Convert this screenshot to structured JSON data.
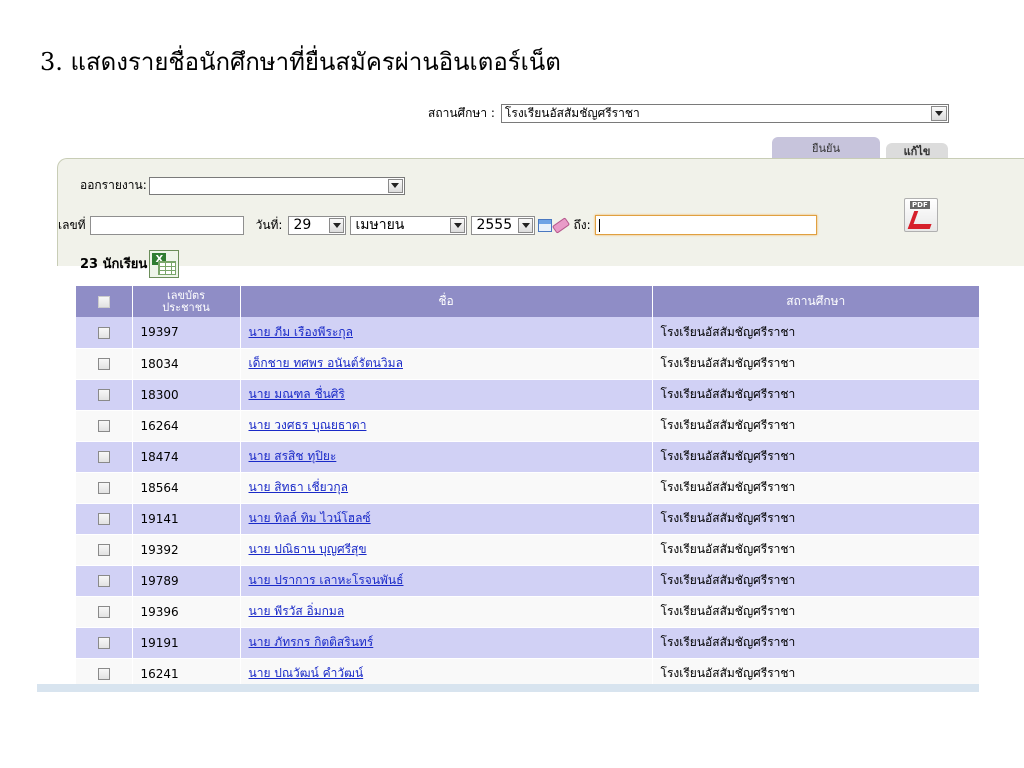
{
  "heading": "3. แสดงรายชื่อนักศึกษาที่ยื่นสมัครผ่านอินเตอร์เน็ต",
  "school_filter": {
    "label": "สถานศึกษา :",
    "value": "โรงเรียนอัสสัมชัญศรีราชา"
  },
  "tabs": {
    "confirm": "ยืนยัน",
    "edit": "แก้ไข"
  },
  "report": {
    "label": "ออกรายงาน:",
    "value": ""
  },
  "filter": {
    "number_label": "เลขที่",
    "number_value": "",
    "date_label": "วันที่:",
    "day": "29",
    "month": "เมษายน",
    "year": "2555",
    "to_label": "ถึง:",
    "to_value": ""
  },
  "pdf_icon_text": "PDF",
  "excel_icon_text": "X",
  "count_text": "23 นักเรียน",
  "table": {
    "headers": {
      "id_line1": "เลขบัตร",
      "id_line2": "ประชาชน",
      "name": "ชื่อ",
      "school": "สถานศึกษา"
    },
    "rows": [
      {
        "id": "19397",
        "name": "นาย ภีม เรืองพีระกุล",
        "school": "โรงเรียนอัสสัมชัญศรีราชา"
      },
      {
        "id": "18034",
        "name": "เด็กชาย ทศพร อนันต์รัตนวิมล",
        "school": "โรงเรียนอัสสัมชัญศรีราชา"
      },
      {
        "id": "18300",
        "name": "นาย มณฑล ชื่นศิริ",
        "school": "โรงเรียนอัสสัมชัญศรีราชา"
      },
      {
        "id": "16264",
        "name": "นาย วงศธร บุณยธาดา",
        "school": "โรงเรียนอัสสัมชัญศรีราชา"
      },
      {
        "id": "18474",
        "name": "นาย สรสิช ทุปิยะ",
        "school": "โรงเรียนอัสสัมชัญศรีราชา"
      },
      {
        "id": "18564",
        "name": "นาย สิทธา เชี่ยวกุล",
        "school": "โรงเรียนอัสสัมชัญศรีราชา"
      },
      {
        "id": "19141",
        "name": "นาย ทิลล์ ทิม ไวน์โฮลซ์",
        "school": "โรงเรียนอัสสัมชัญศรีราชา"
      },
      {
        "id": "19392",
        "name": "นาย ปณิธาน บุญศรีสุข",
        "school": "โรงเรียนอัสสัมชัญศรีราชา"
      },
      {
        "id": "19789",
        "name": "นาย ปราการ เลาหะโรจนพันธ์",
        "school": "โรงเรียนอัสสัมชัญศรีราชา"
      },
      {
        "id": "19396",
        "name": "นาย พีรวัส อิ่มกมล",
        "school": "โรงเรียนอัสสัมชัญศรีราชา"
      },
      {
        "id": "19191",
        "name": "นาย ภัทรกร กิตติสรินทร์",
        "school": "โรงเรียนอัสสัมชัญศรีราชา"
      },
      {
        "id": "16241",
        "name": "นาย ปณวัฒน์ คำวัฒน์",
        "school": "โรงเรียนอัสสัมชัญศรีราชา"
      }
    ]
  }
}
